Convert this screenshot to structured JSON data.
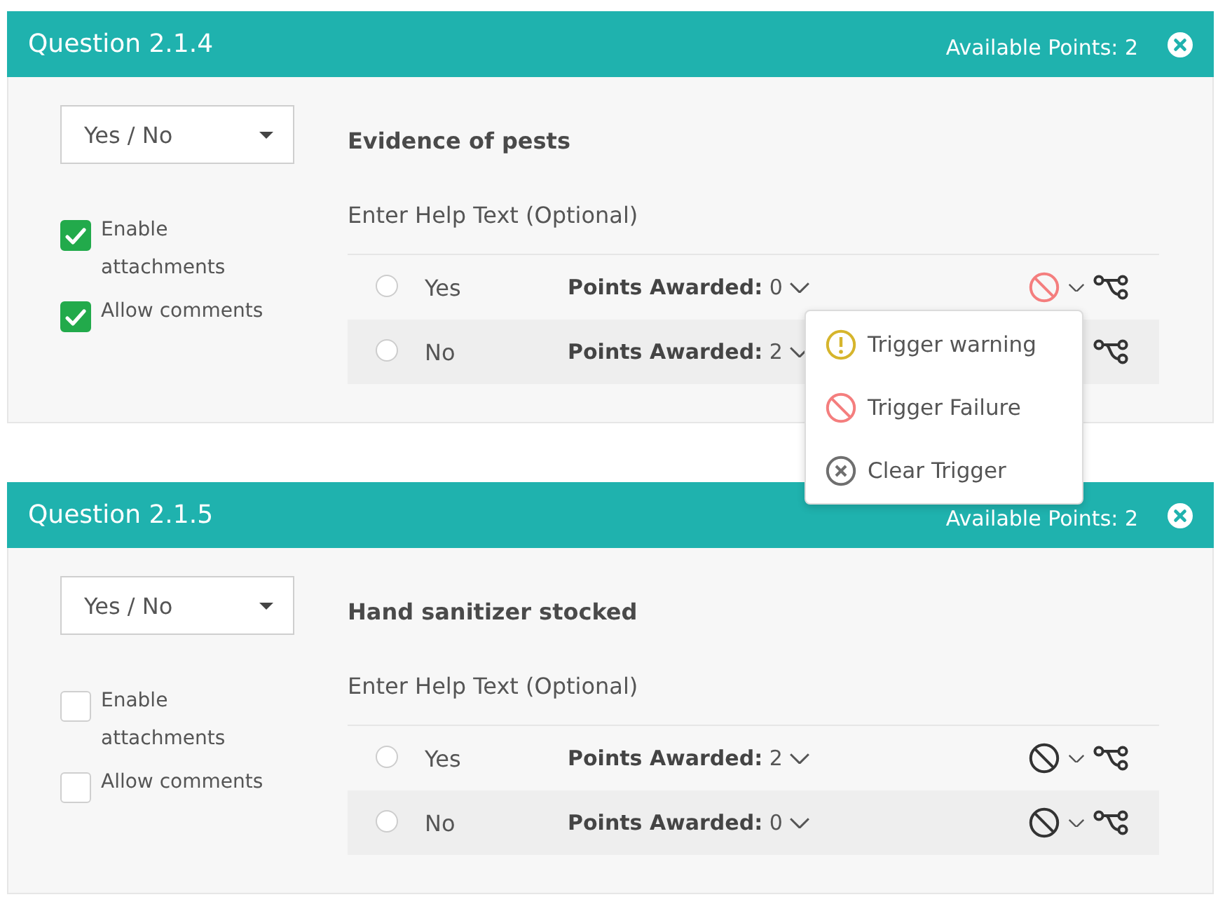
{
  "cards": [
    {
      "title": "Question 2.1.4",
      "points_text": "Available Points: 2",
      "type_select": {
        "value": "Yes / No"
      },
      "settings": [
        {
          "label": "Enable attachments",
          "checked": true
        },
        {
          "label": "Allow comments",
          "checked": true
        }
      ],
      "question": "Evidence of pests",
      "help_placeholder": "Enter Help Text (Optional)",
      "options": [
        {
          "label": "Yes",
          "selected": false,
          "points_label": "Points Awarded:",
          "points": "0",
          "failure_trigger": true,
          "trigger_menu": {
            "items": [
              {
                "kind": "warning",
                "label": "Trigger warning"
              },
              {
                "kind": "failure",
                "label": "Trigger Failure"
              },
              {
                "kind": "clear",
                "label": "Clear Trigger"
              }
            ]
          }
        },
        {
          "label": "No",
          "selected": false,
          "points_label": "Points Awarded:",
          "points": "2"
        }
      ]
    },
    {
      "title": "Question 2.1.5",
      "points_text": "Available Points: 2",
      "type_select": {
        "value": "Yes / No"
      },
      "settings": [
        {
          "label": "Enable attachments",
          "checked": false
        },
        {
          "label": "Allow comments",
          "checked": false
        }
      ],
      "question": "Hand sanitizer stocked",
      "help_placeholder": "Enter Help Text (Optional)",
      "options": [
        {
          "label": "Yes",
          "selected": false,
          "points_label": "Points Awarded:",
          "points": "2",
          "failure_trigger": false
        },
        {
          "label": "No",
          "selected": false,
          "points_label": "Points Awarded:",
          "points": "0",
          "failure_trigger": false
        }
      ]
    }
  ]
}
